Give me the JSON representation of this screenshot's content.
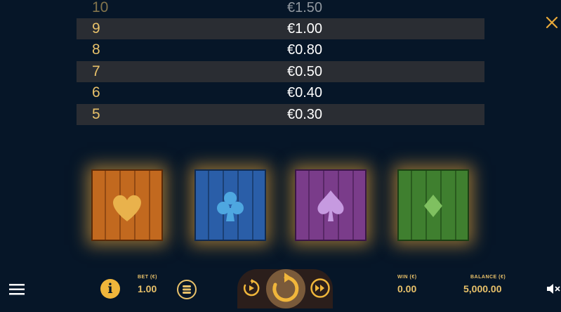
{
  "paytable": {
    "rows": [
      {
        "count": "10",
        "prize": "€1.50"
      },
      {
        "count": "9",
        "prize": "€1.00"
      },
      {
        "count": "8",
        "prize": "€0.80"
      },
      {
        "count": "7",
        "prize": "€0.50"
      },
      {
        "count": "6",
        "prize": "€0.40"
      },
      {
        "count": "5",
        "prize": "€0.30"
      }
    ]
  },
  "symbols": [
    {
      "name": "heart",
      "color": "#c2691f"
    },
    {
      "name": "club",
      "color": "#2a5ea8"
    },
    {
      "name": "spade",
      "color": "#7a3c8a"
    },
    {
      "name": "diamond",
      "color": "#3f7f2f"
    }
  ],
  "bottom_bar": {
    "bet_label": "BET (€)",
    "bet_value": "1.00",
    "win_label": "WIN (€)",
    "win_value": "0.00",
    "balance_label": "BALANCE (€)",
    "balance_value": "5,000.00"
  },
  "colors": {
    "background": "#061628",
    "accent": "#e8c16a",
    "row_alt": "#2a2d33"
  },
  "icons": [
    "close-icon",
    "menu-icon",
    "info-icon",
    "coin-stack-icon",
    "autoplay-icon",
    "spin-icon",
    "turbo-icon",
    "sound-muted-icon"
  ]
}
